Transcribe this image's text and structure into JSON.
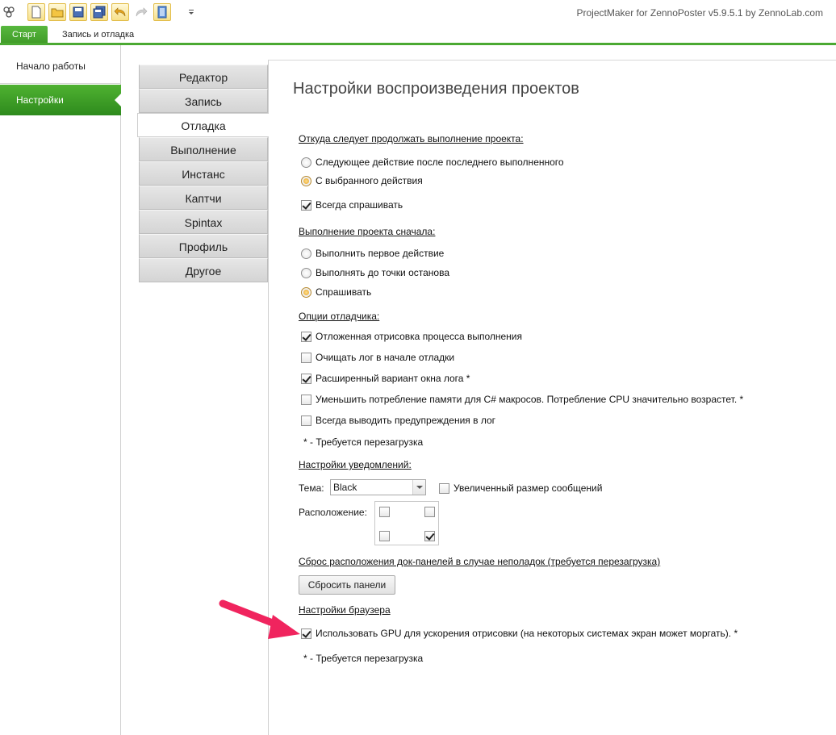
{
  "titlebar": {
    "app_title": "ProjectMaker for ZennoPoster v5.9.5.1 by ZennoLab.com",
    "quick_access_icons": [
      "logo-icon",
      "new-file-icon",
      "open-folder-icon",
      "save-icon",
      "save-all-icon",
      "undo-icon",
      "redo-icon",
      "book-icon",
      "customize-dropdown-icon"
    ]
  },
  "ribbon": {
    "tabs": [
      {
        "label": "Старт",
        "active": true
      },
      {
        "label": "Запись и отладка",
        "active": false
      }
    ],
    "accent": "#4ba932"
  },
  "sidebar": {
    "items": [
      {
        "label": "Начало работы",
        "active": false
      },
      {
        "label": "Настройки",
        "active": true
      }
    ]
  },
  "vtabs": [
    {
      "label": "Редактор",
      "active": false
    },
    {
      "label": "Запись",
      "active": false
    },
    {
      "label": "Отладка",
      "active": true
    },
    {
      "label": "Выполнение",
      "active": false
    },
    {
      "label": "Инстанс",
      "active": false
    },
    {
      "label": "Каптчи",
      "active": false
    },
    {
      "label": "Spintax",
      "active": false
    },
    {
      "label": "Профиль",
      "active": false
    },
    {
      "label": "Другое",
      "active": false
    }
  ],
  "content": {
    "title": "Настройки воспроизведения проектов",
    "continue_section": {
      "label": "Откуда следует продолжать выполнение проекта:",
      "opt_next": {
        "label": "Следующее действие после последнего выполненного",
        "checked": false
      },
      "opt_selected": {
        "label": "С выбранного действия",
        "checked": true
      },
      "always_ask": {
        "label": "Всегда спрашивать",
        "checked": true
      }
    },
    "start_section": {
      "label": "Выполнение проекта сначала:",
      "opt_first": {
        "label": "Выполнить первое действие",
        "checked": false
      },
      "opt_breakpoint": {
        "label": "Выполнять до точки останова",
        "checked": false
      },
      "opt_ask": {
        "label": "Спрашивать",
        "checked": true
      }
    },
    "debugger_section": {
      "label": "Опции отладчика:",
      "deferred_render": {
        "label": "Отложенная отрисовка процесса выполнения",
        "checked": true
      },
      "clear_log": {
        "label": "Очищать лог в начале отладки",
        "checked": false
      },
      "extended_log": {
        "label": "Расширенный вариант окна лога *",
        "checked": true
      },
      "reduce_memory": {
        "label": "Уменьшить потребление памяти для C# макросов. Потребление CPU значительно возрастет. *",
        "checked": false
      },
      "always_warnings": {
        "label": "Всегда выводить предупреждения в лог",
        "checked": false
      },
      "note": "* - Требуется перезагрузка"
    },
    "notifications_section": {
      "label": "Настройки уведомлений:",
      "theme_label": "Тема:",
      "theme_value": "Black",
      "bigger_messages": {
        "label": "Увеличенный размер сообщений",
        "checked": false
      },
      "position_label": "Расположение:",
      "position_top_left": false,
      "position_top_right": false,
      "position_bottom_left": false,
      "position_bottom_right": true
    },
    "reset_section": {
      "label": "Сброс расположения док-панелей в случае неполадок (требуется перезагрузка)",
      "button": "Сбросить панели"
    },
    "browser_section": {
      "label": "Настройки браузера",
      "use_gpu": {
        "label": "Использовать GPU для ускорения отрисовки (на некоторых системах экран может моргать). *",
        "checked": true
      },
      "note": "* - Требуется перезагрузка"
    },
    "annotation_arrow_color": "#f0245e"
  }
}
